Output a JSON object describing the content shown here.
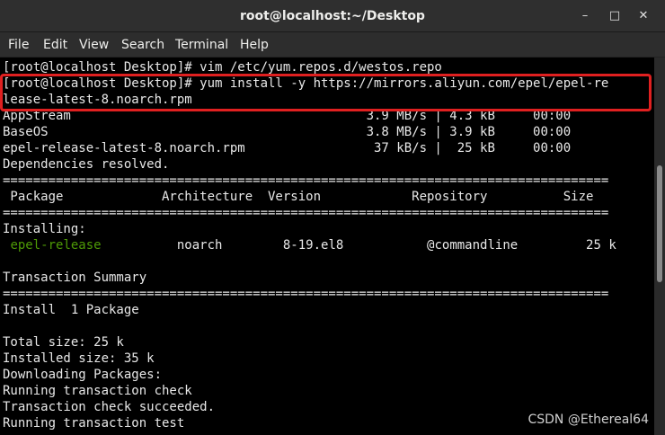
{
  "window": {
    "title": "root@localhost:~/Desktop",
    "minimize_icon": "minimize-icon",
    "maximize_icon": "maximize-icon",
    "close_icon": "close-icon"
  },
  "menu": [
    "File",
    "Edit",
    "View",
    "Search",
    "Terminal",
    "Help"
  ],
  "terminal": {
    "lines": [
      "[root@localhost Desktop]# vim /etc/yum.repos.d/westos.repo",
      "[root@localhost Desktop]# yum install -y https://mirrors.aliyun.com/epel/epel-re",
      "lease-latest-8.noarch.rpm",
      "AppStream                                       3.9 MB/s | 4.3 kB     00:00",
      "BaseOS                                          3.8 MB/s | 3.9 kB     00:00",
      "epel-release-latest-8.noarch.rpm                 37 kB/s |  25 kB     00:00",
      "Dependencies resolved.",
      "================================================================================",
      " Package             Architecture  Version            Repository          Size",
      "================================================================================",
      "Installing:",
      " ",
      "",
      "Transaction Summary",
      "================================================================================",
      "Install  1 Package",
      "",
      "Total size: 25 k",
      "Installed size: 35 k",
      "Downloading Packages:",
      "Running transaction check",
      "Transaction check succeeded.",
      "Running transaction test"
    ],
    "package_row": {
      "name": "epel-release",
      "rest": "          noarch        8-19.el8           @commandline         25 k"
    },
    "accent_green": "#4e9a06",
    "highlight_color": "#e02020"
  },
  "watermark": "CSDN @Ethereal64"
}
